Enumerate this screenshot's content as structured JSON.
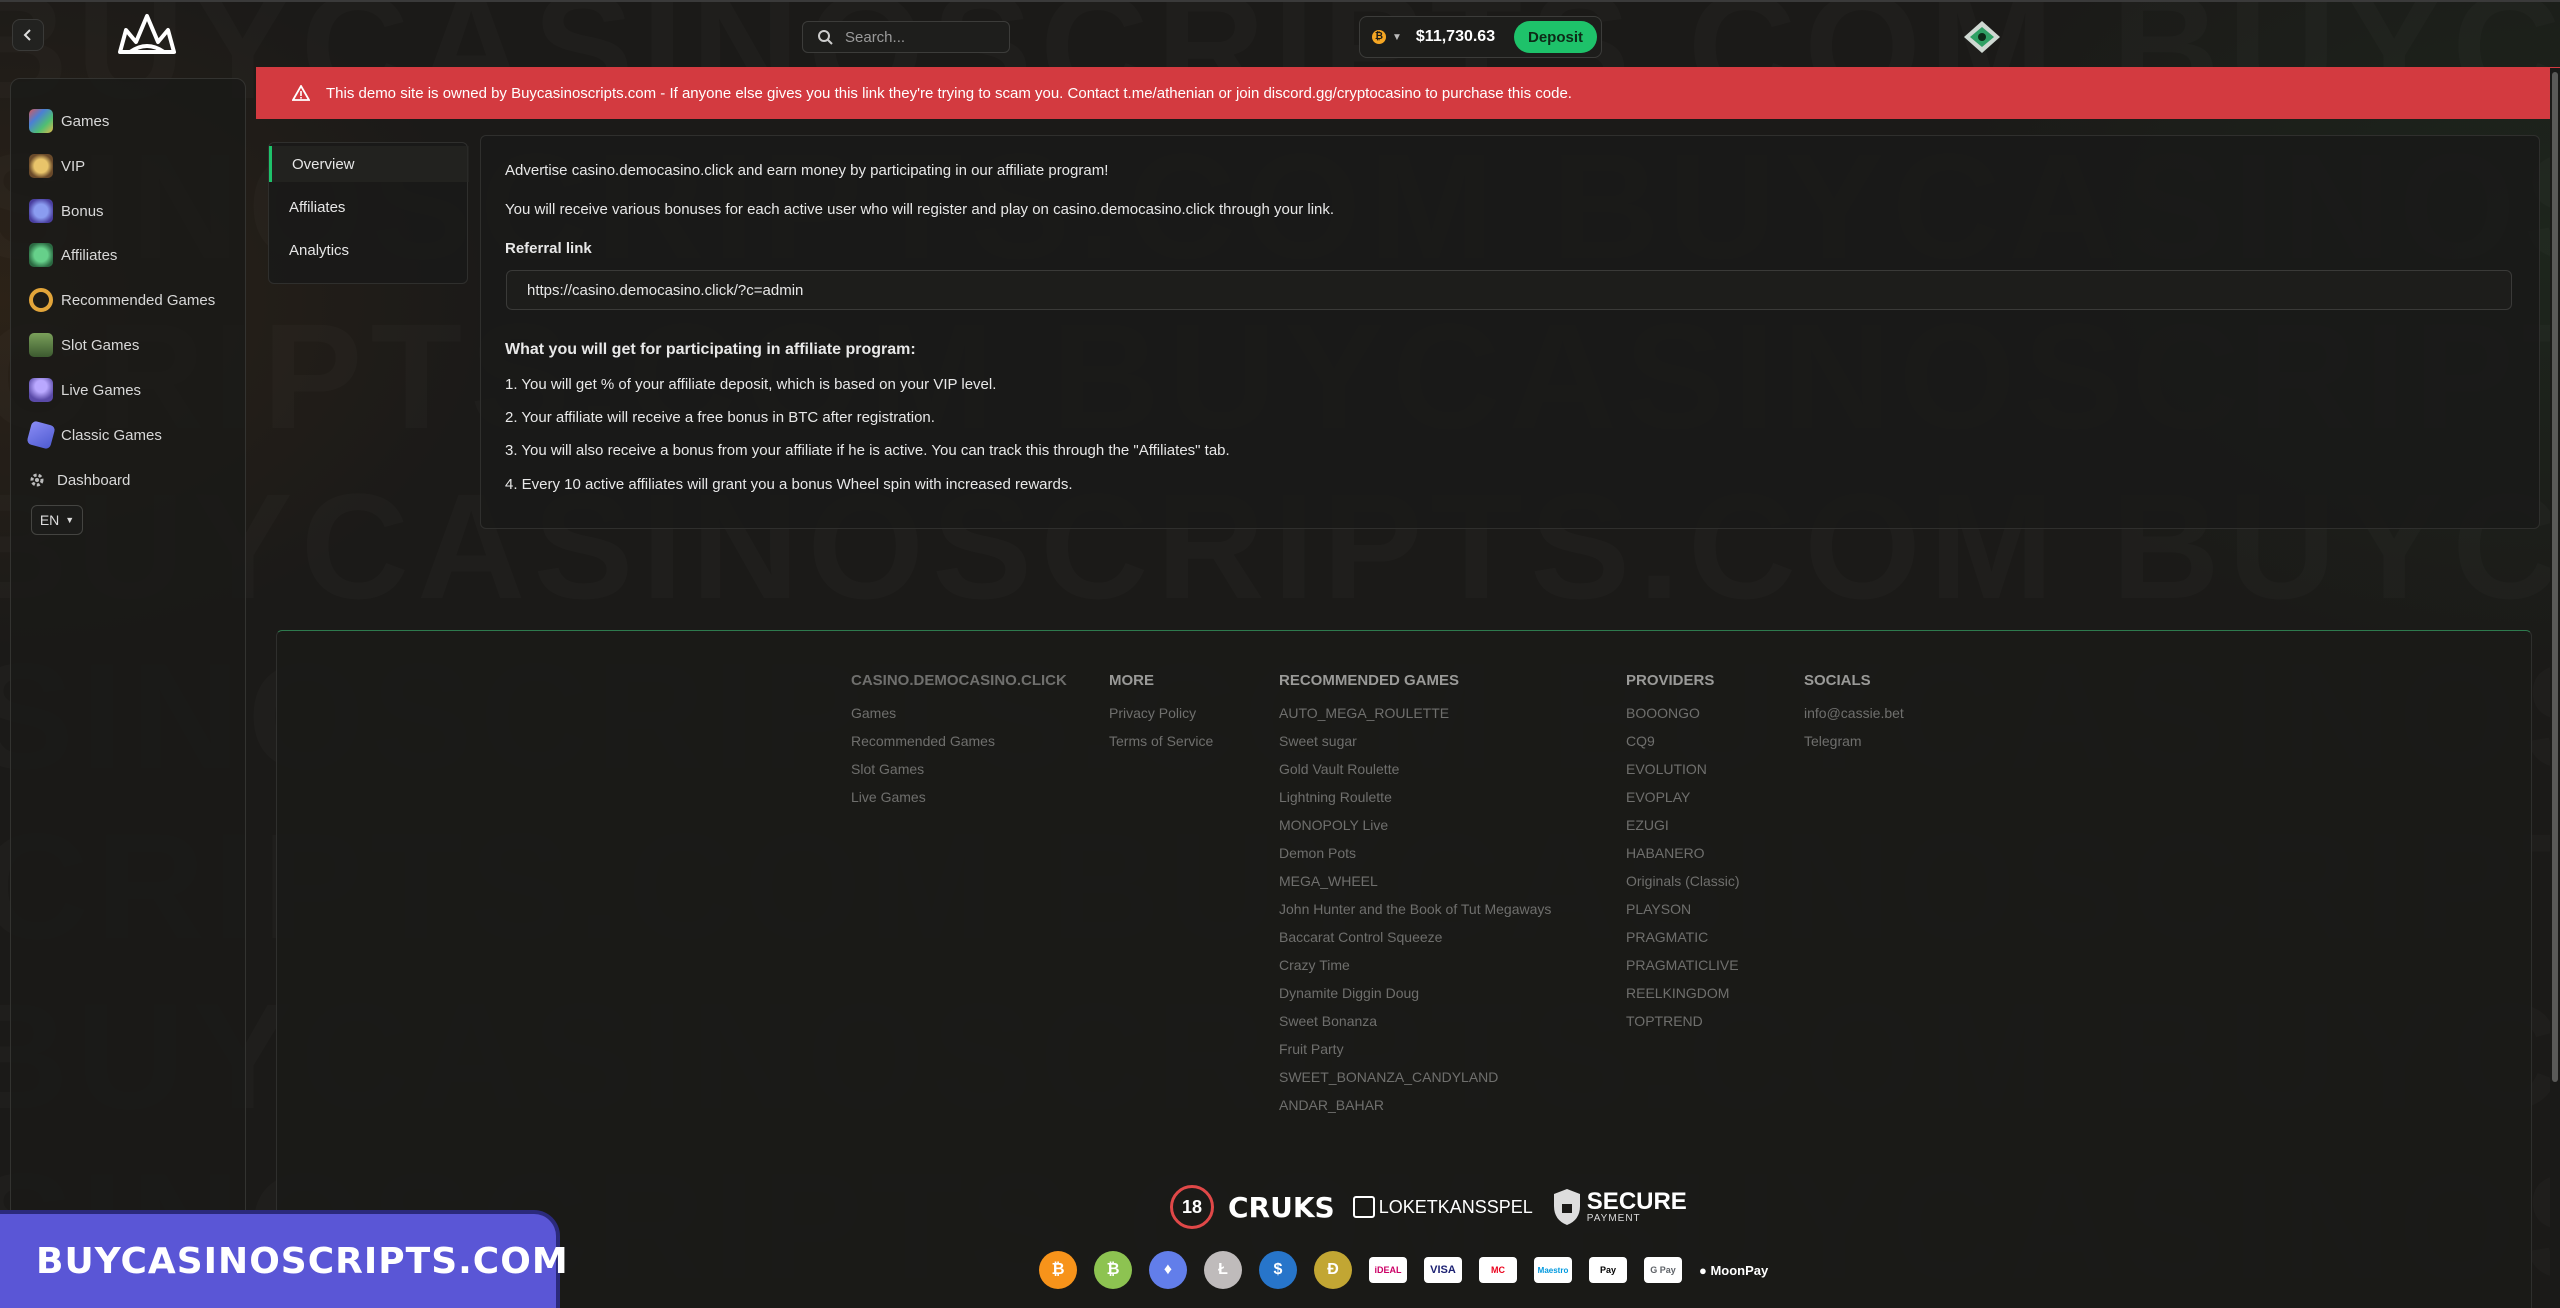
{
  "watermark": "BUYCASINOSCRIPTS.COM BUYCASINOSCRIPTS.COM BUYCASINOSCRIPTS.COM",
  "header": {
    "search_placeholder": "Search...",
    "balance": "$11,730.63",
    "currency_icon": "bitcoin-icon",
    "deposit_label": "Deposit"
  },
  "sidebar": {
    "items": [
      {
        "label": "Games",
        "icon": "games-icon"
      },
      {
        "label": "VIP",
        "icon": "crown-icon"
      },
      {
        "label": "Bonus",
        "icon": "gift-icon"
      },
      {
        "label": "Affiliates",
        "icon": "megaphone-icon"
      },
      {
        "label": "Recommended Games",
        "icon": "horseshoe-icon"
      },
      {
        "label": "Slot Games",
        "icon": "slot-machine-icon"
      },
      {
        "label": "Live Games",
        "icon": "dealer-icon"
      },
      {
        "label": "Classic Games",
        "icon": "dice-icon"
      },
      {
        "label": "Dashboard",
        "icon": "gear-icon"
      }
    ],
    "language": "EN"
  },
  "alert": {
    "text": "This demo site is owned by Buycasinoscripts.com - If anyone else gives you this link they're trying to scam you. Contact t.me/athenian or join discord.gg/cryptocasino to purchase this code."
  },
  "tabs": [
    "Overview",
    "Affiliates",
    "Analytics"
  ],
  "overview": {
    "intro1": "Advertise casino.democasino.click and earn money by participating in our affiliate program!",
    "intro2": "You will receive various bonuses for each active user who will register and play on casino.democasino.click through your link.",
    "referral_label": "Referral link",
    "referral_value": "https://casino.democasino.click/?c=admin",
    "benefits_title": "What you will get for participating in affiliate program:",
    "benefits": [
      "1. You will get % of your affiliate deposit, which is based on your VIP level.",
      "2. Your affiliate will receive a free bonus in BTC after registration.",
      "3. You will also receive a bonus from your affiliate if he is active. You can track this through the \"Affiliates\" tab.",
      "4. Every 10 active affiliates will grant you a bonus Wheel spin with increased rewards."
    ]
  },
  "footer": {
    "columns": [
      {
        "head": "CASINO.DEMOCASINO.CLICK",
        "links": [
          "Games",
          "Recommended Games",
          "Slot Games",
          "Live Games"
        ]
      },
      {
        "head": "MORE",
        "links": [
          "Privacy Policy",
          "Terms of Service"
        ]
      },
      {
        "head": "RECOMMENDED GAMES",
        "links": [
          "AUTO_MEGA_ROULETTE",
          "Sweet sugar",
          "Gold Vault Roulette",
          "Lightning Roulette",
          "MONOPOLY Live",
          "Demon Pots",
          "MEGA_WHEEL",
          "John Hunter and the Book of Tut Megaways",
          "Baccarat Control Squeeze",
          "Crazy Time",
          "Dynamite Diggin Doug",
          "Sweet Bonanza",
          "Fruit Party",
          "SWEET_BONANZA_CANDYLAND",
          "ANDAR_BAHAR"
        ]
      },
      {
        "head": "PROVIDERS",
        "links": [
          "BOOONGO",
          "CQ9",
          "EVOLUTION",
          "EVOPLAY",
          "EZUGI",
          "HABANERO",
          "Originals (Classic)",
          "PLAYSON",
          "PRAGMATIC",
          "PRAGMATICLIVE",
          "REELKINGDOM",
          "TOPTREND"
        ]
      },
      {
        "head": "SOCIALS",
        "links": [
          "info@cassie.bet",
          "Telegram"
        ]
      }
    ],
    "badges": {
      "age": "18",
      "cruks": "CRUKS",
      "loket": "LOKETKANSSPEL",
      "secure": "SECURE",
      "secure_sub": "PAYMENT"
    },
    "payments": [
      {
        "label": "₿",
        "color": "#f7931a"
      },
      {
        "label": "₿",
        "color": "#8dc351"
      },
      {
        "label": "♦",
        "color": "#627eea"
      },
      {
        "label": "Ł",
        "color": "#bfbbbb"
      },
      {
        "label": "$",
        "color": "#2775ca"
      },
      {
        "label": "Ð",
        "color": "#c2a633"
      }
    ],
    "cards": [
      "iDEAL",
      "VISA",
      "MC",
      "Maestro",
      "Pay",
      "G Pay"
    ],
    "moonpay": "MoonPay"
  },
  "promo": {
    "text": "BUYCASINOSCRIPTS.COM"
  }
}
